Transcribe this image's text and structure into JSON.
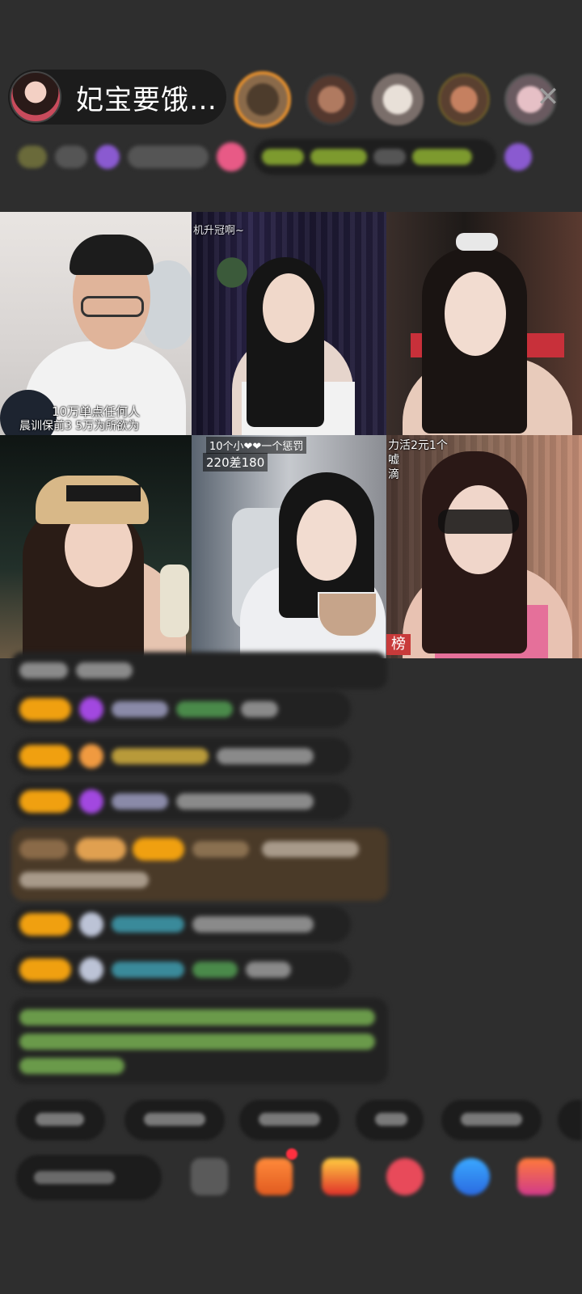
{
  "host": {
    "name": "妃宝要饿…"
  },
  "controls": {
    "close_glyph": "✕"
  },
  "grid_overlays": {
    "cell1_line1": "10万单点任何人",
    "cell1_line2": "晨训保前3   5万为所欲为",
    "cell2_top": "机升冠啊~",
    "cell5_top": "10个小❤❤一个惩罚",
    "cell5_score": "220差180",
    "cell6_line1": "力活2元1个",
    "cell6_line2": "嘘",
    "cell6_line3": "滴",
    "cell6_rank": "榜"
  },
  "colors": {
    "background": "#2e2e2e",
    "level_badge": "#f0a010",
    "rank_badge": "#c83a3a"
  }
}
